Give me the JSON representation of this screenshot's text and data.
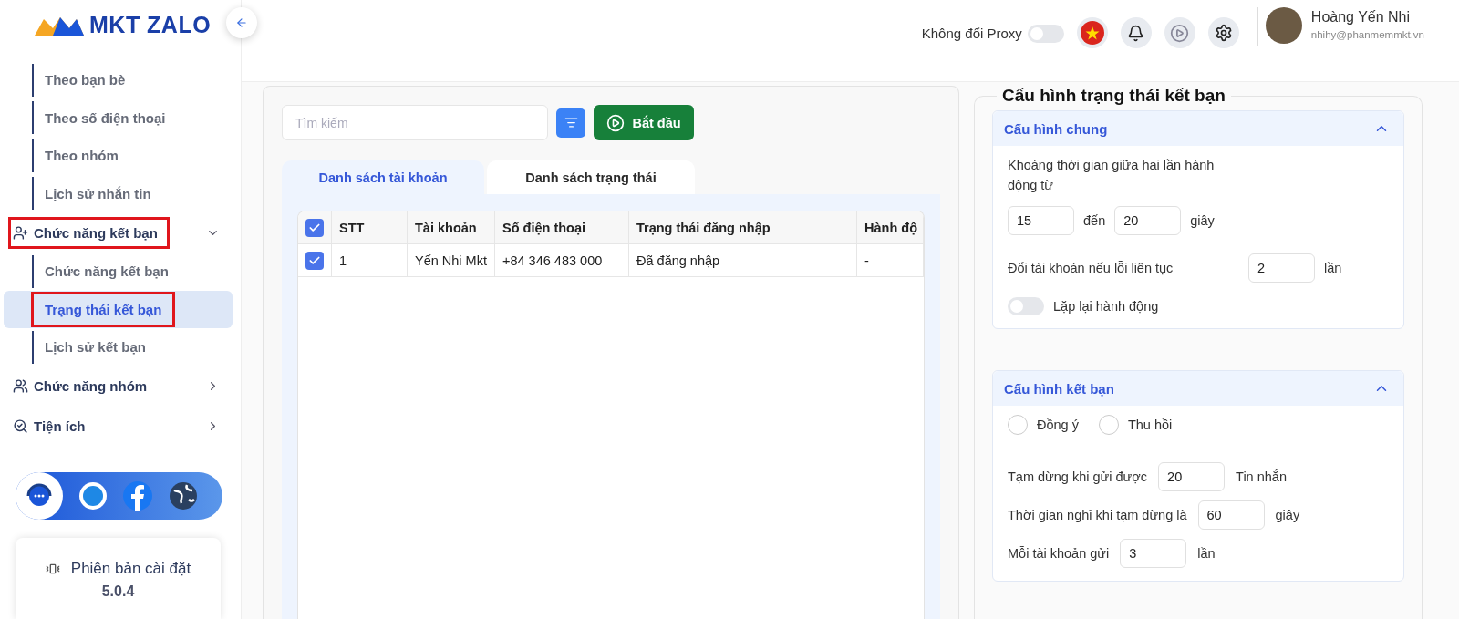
{
  "sidebar": {
    "logo": "MKT ZALO",
    "items": [
      {
        "kind": "sub",
        "label": "Theo bạn bè",
        "selected": false,
        "highlighted": false
      },
      {
        "kind": "sub",
        "label": "Theo số điện thoại",
        "selected": false,
        "highlighted": false
      },
      {
        "kind": "sub",
        "label": "Theo nhóm",
        "selected": false,
        "highlighted": false
      },
      {
        "kind": "sub",
        "label": "Lịch sử nhắn tin",
        "selected": false,
        "highlighted": false
      },
      {
        "kind": "group",
        "label": "Chức năng kết bạn",
        "expanded": true,
        "highlighted": true,
        "children": [
          {
            "label": "Chức năng kết bạn",
            "selected": false,
            "highlighted": false
          },
          {
            "label": "Trạng thái kết bạn",
            "selected": true,
            "highlighted": true
          },
          {
            "label": "Lịch sử kết bạn",
            "selected": false,
            "highlighted": false
          }
        ]
      },
      {
        "kind": "group",
        "label": "Chức năng nhóm",
        "expanded": false,
        "highlighted": false
      },
      {
        "kind": "group",
        "label": "Tiện ích",
        "expanded": false,
        "highlighted": false
      }
    ],
    "version": {
      "label": "Phiên bản cài đặt",
      "number": "5.0.4"
    }
  },
  "header": {
    "proxy_label": "Không đổi Proxy",
    "proxy_on": false,
    "user_name": "Hoàng Yến Nhi",
    "user_email": "nhihy@phanmemmkt.vn"
  },
  "toolbar": {
    "search": {
      "placeholder": "Tìm kiếm"
    },
    "start_button": "Bắt đầu"
  },
  "tabs": [
    {
      "label": "Danh sách tài khoản",
      "selected": true
    },
    {
      "label": "Danh sách trạng thái",
      "selected": false
    }
  ],
  "table": {
    "all_checked": true,
    "columns": [
      "STT",
      "Tài khoản",
      "Số điện thoại",
      "Trạng thái đăng nhập",
      "Hành độ"
    ],
    "rows": [
      {
        "checked": true,
        "cells": [
          "1",
          "Yến Nhi Mkt",
          "+84 346 483 000",
          "Đã đăng nhập",
          "-"
        ]
      }
    ]
  },
  "config": {
    "title": "Cấu hình trạng thái kết bạn",
    "general": {
      "title": "Cấu hình chung",
      "expanded": true,
      "interval_label": "Khoảng thời gian giữa hai lần hành động từ",
      "interval_from": "15",
      "to_label": "đến",
      "interval_to": "20",
      "interval_unit": "giây",
      "switch_label": "Đổi tài khoản nếu lỗi liên tục",
      "switch_value": "2",
      "switch_unit": "lần",
      "repeat_label": "Lặp lại hành động",
      "repeat_on": false
    },
    "friend": {
      "title": "Cấu hình kết bạn",
      "expanded": true,
      "options": [
        {
          "label": "Đồng ý",
          "selected": false
        },
        {
          "label": "Thu hồi",
          "selected": false
        }
      ],
      "fields": [
        {
          "label": "Tạm dừng khi gửi được",
          "value": "20",
          "unit": "Tin nhắn"
        },
        {
          "label": "Thời gian nghỉ khi tạm dừng là",
          "value": "60",
          "unit": "giây"
        },
        {
          "label": "Mỗi tài khoản gửi",
          "value": "3",
          "unit": "lần"
        }
      ]
    }
  }
}
